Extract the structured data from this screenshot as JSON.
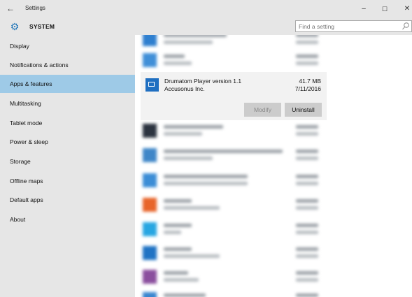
{
  "window": {
    "title": "Settings",
    "back_glyph": "←",
    "min_glyph": "–",
    "max_glyph": "☐",
    "close_glyph": "✕"
  },
  "sidebar": {
    "header": "SYSTEM",
    "items": [
      {
        "label": "Display",
        "active": false
      },
      {
        "label": "Notifications & actions",
        "active": false
      },
      {
        "label": "Apps & features",
        "active": true
      },
      {
        "label": "Multitasking",
        "active": false
      },
      {
        "label": "Tablet mode",
        "active": false
      },
      {
        "label": "Power & sleep",
        "active": false
      },
      {
        "label": "Storage",
        "active": false
      },
      {
        "label": "Offline maps",
        "active": false
      },
      {
        "label": "Default apps",
        "active": false
      },
      {
        "label": "About",
        "active": false
      }
    ]
  },
  "search": {
    "placeholder": "Find a setting"
  },
  "selected_app": {
    "name": "Drumatom Player version 1.1",
    "publisher": "Accusonus Inc.",
    "size": "41.7 MB",
    "date": "7/11/2016",
    "modify_label": "Modify",
    "uninstall_label": "Uninstall"
  },
  "colors": {
    "accent": "#9ecae7",
    "chrome": "#e6e6e6",
    "app_icon": "#1f6fc1"
  }
}
